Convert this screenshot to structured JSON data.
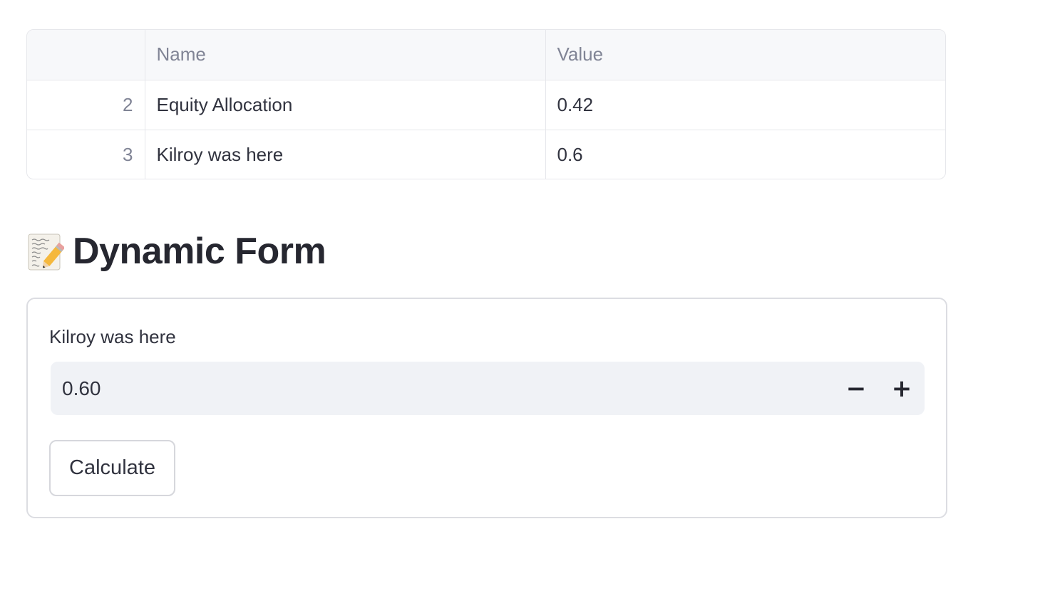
{
  "table": {
    "columns": [
      "",
      "Name",
      "Value"
    ],
    "rows": [
      {
        "index": "2",
        "name": "Equity Allocation",
        "value": "0.42"
      },
      {
        "index": "3",
        "name": "Kilroy was here",
        "value": "0.6"
      }
    ]
  },
  "heading": {
    "icon": "memo-icon",
    "title": "Dynamic Form"
  },
  "form": {
    "field_label": "Kilroy was here",
    "field_value": "0.60",
    "decrement_label": "−",
    "increment_label": "+",
    "submit_label": "Calculate"
  }
}
